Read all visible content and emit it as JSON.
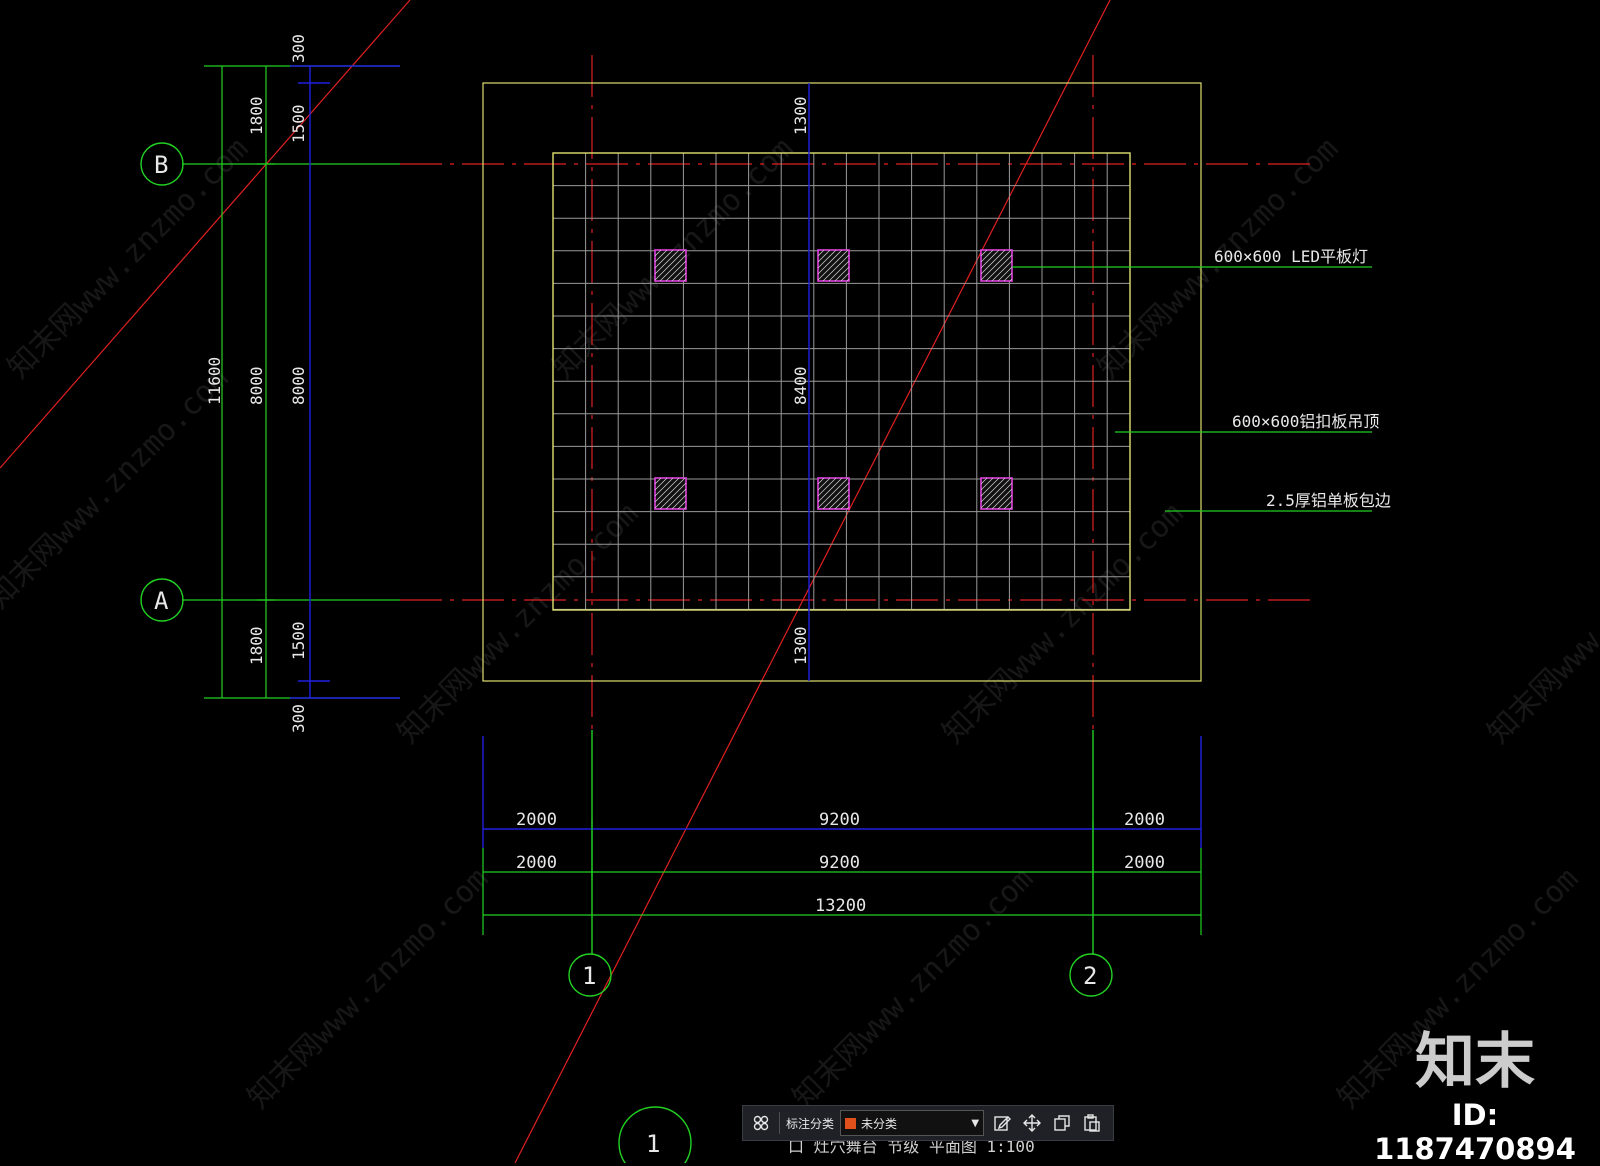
{
  "drawing": {
    "axes": {
      "b": "B",
      "a": "A",
      "one": "1",
      "two": "2",
      "detail": "1"
    },
    "left_dims": {
      "outer_total": "11600",
      "col2_top": "1800",
      "col2_mid": "8000",
      "col2_bot": "1800",
      "col3_top_ext": "300",
      "col3_top": "1500",
      "col3_mid": "8000",
      "col3_bot": "1500",
      "col3_bot_ext": "300"
    },
    "center_dims": {
      "top": "1300",
      "mid": "8400",
      "bottom": "1300"
    },
    "bottom_dims": {
      "row1": [
        "2000",
        "9200",
        "2000"
      ],
      "row2": [
        "2000",
        "9200",
        "2000"
      ],
      "total": "13200"
    },
    "callouts": {
      "led": "600×600 LED平板灯",
      "ceiling": "600×600铝扣板吊顶",
      "edge": "2.5厚铝单板包边"
    },
    "title_partial": "口 灶穴舞台 节级 平面图   1:100",
    "watermark": "知末网www.znzmo.com"
  },
  "colors": {
    "background": "#000000",
    "dim_green": "#22d022",
    "dim_blue": "#2020e0",
    "axis_red": "#e02020",
    "frame_yellow": "#e0e070",
    "grid_gray": "#9a9a9a",
    "fixture_magenta": "#e040e0"
  },
  "toolbar": {
    "layout_icon": "grid-layout-icon",
    "category_label": "标注分类",
    "category_value": "未分类",
    "category_color": "#e0501a",
    "edit_icon": "edit-icon",
    "move_icon": "move-icon",
    "copy_icon": "copy-icon",
    "paste_icon": "paste-icon"
  },
  "brand": {
    "name": "知末",
    "id": "ID: 1187470894"
  }
}
